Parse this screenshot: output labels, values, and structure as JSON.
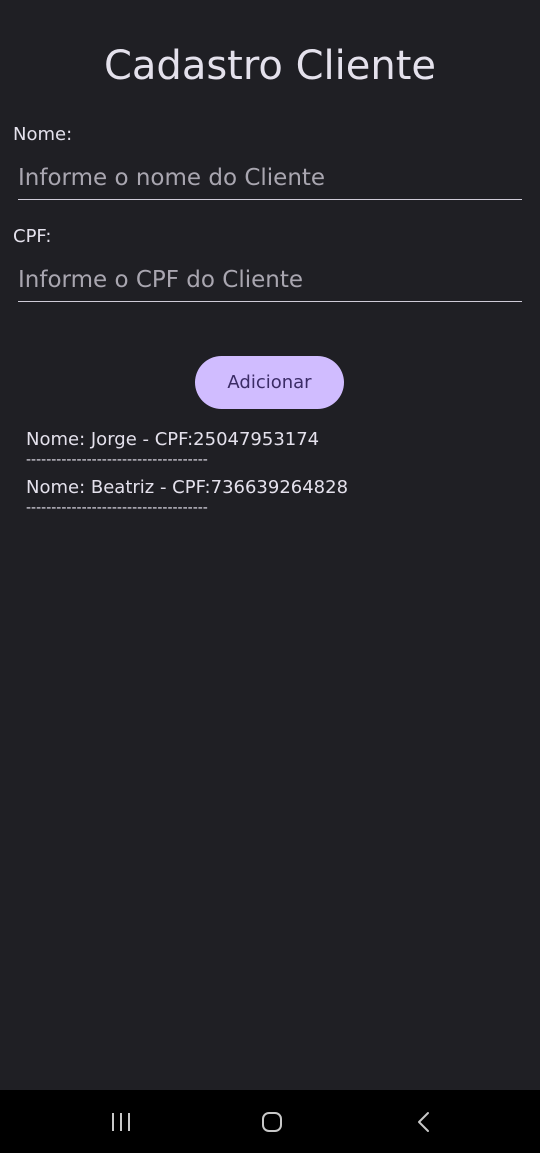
{
  "header": {
    "title": "Cadastro Cliente"
  },
  "form": {
    "name_label": "Nome:",
    "name_placeholder": "Informe o nome do Cliente",
    "cpf_label": "CPF:",
    "cpf_placeholder": "Informe o CPF do Cliente",
    "add_button_label": "Adicionar"
  },
  "clients": [
    {
      "text": "Nome: Jorge - CPF:25047953174",
      "separator": "------------------------------------"
    },
    {
      "text": "Nome: Beatriz - CPF:736639264828",
      "separator": "------------------------------------"
    }
  ],
  "nav": {
    "recents_icon": "recents-icon",
    "home_icon": "home-icon",
    "back_icon": "back-icon"
  },
  "colors": {
    "background": "#1f1f24",
    "accent": "#d0bcff",
    "on_accent": "#3b2c66",
    "text": "#e4e1ec",
    "nav_background": "#000000"
  }
}
